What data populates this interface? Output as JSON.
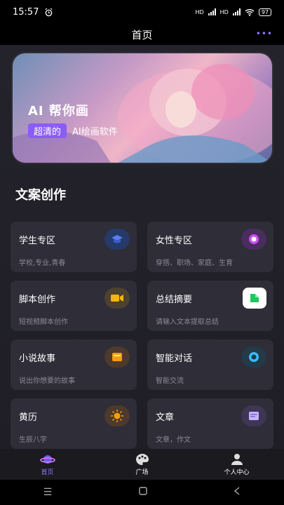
{
  "status": {
    "time": "15:57",
    "network1": "HD",
    "network2": "HD",
    "battery": "97"
  },
  "header": {
    "title": "首页",
    "more_icon": "more-dots-icon"
  },
  "banner": {
    "title": "AI 帮你画",
    "badge": "超清的",
    "subtitle": "AI绘画软件"
  },
  "section": {
    "title": "文案创作"
  },
  "cards": [
    {
      "title": "学生专区",
      "subtitle": "学校,专业,青春",
      "icon": "graduation-cap-icon",
      "color": "#3b5bd8",
      "bg": "#263a6a"
    },
    {
      "title": "女性专区",
      "subtitle": "穿搭、职场、家庭、生育",
      "icon": "female-icon",
      "color": "#c850e8",
      "bg": "#4a2d5f"
    },
    {
      "title": "脚本创作",
      "subtitle": "短视频脚本创作",
      "icon": "video-icon",
      "color": "#f5b60a",
      "bg": "#4d4130"
    },
    {
      "title": "总结摘要",
      "subtitle": "请输入文本提取总结",
      "icon": "summary-icon",
      "color": "#22c55e",
      "bg": "#ffffff"
    },
    {
      "title": "小说故事",
      "subtitle": "说出你想要的故事",
      "icon": "book-icon",
      "color": "#f59e0b",
      "bg": "#4d3a2d"
    },
    {
      "title": "智能对话",
      "subtitle": "智能交流",
      "icon": "chat-icon",
      "color": "#38bdf8",
      "bg": "#233a48"
    },
    {
      "title": "黄历",
      "subtitle": "生辰八字",
      "icon": "sun-icon",
      "color": "#f59e0b",
      "bg": "#4d3a2d"
    },
    {
      "title": "文章",
      "subtitle": "文章，作文",
      "icon": "article-icon",
      "color": "#c4b5fd",
      "bg": "#3f3656"
    }
  ],
  "nav": [
    {
      "label": "首页",
      "icon": "planet-icon",
      "active": true
    },
    {
      "label": "广场",
      "icon": "palette-icon",
      "active": false
    },
    {
      "label": "个人中心",
      "icon": "user-icon",
      "active": false
    }
  ]
}
